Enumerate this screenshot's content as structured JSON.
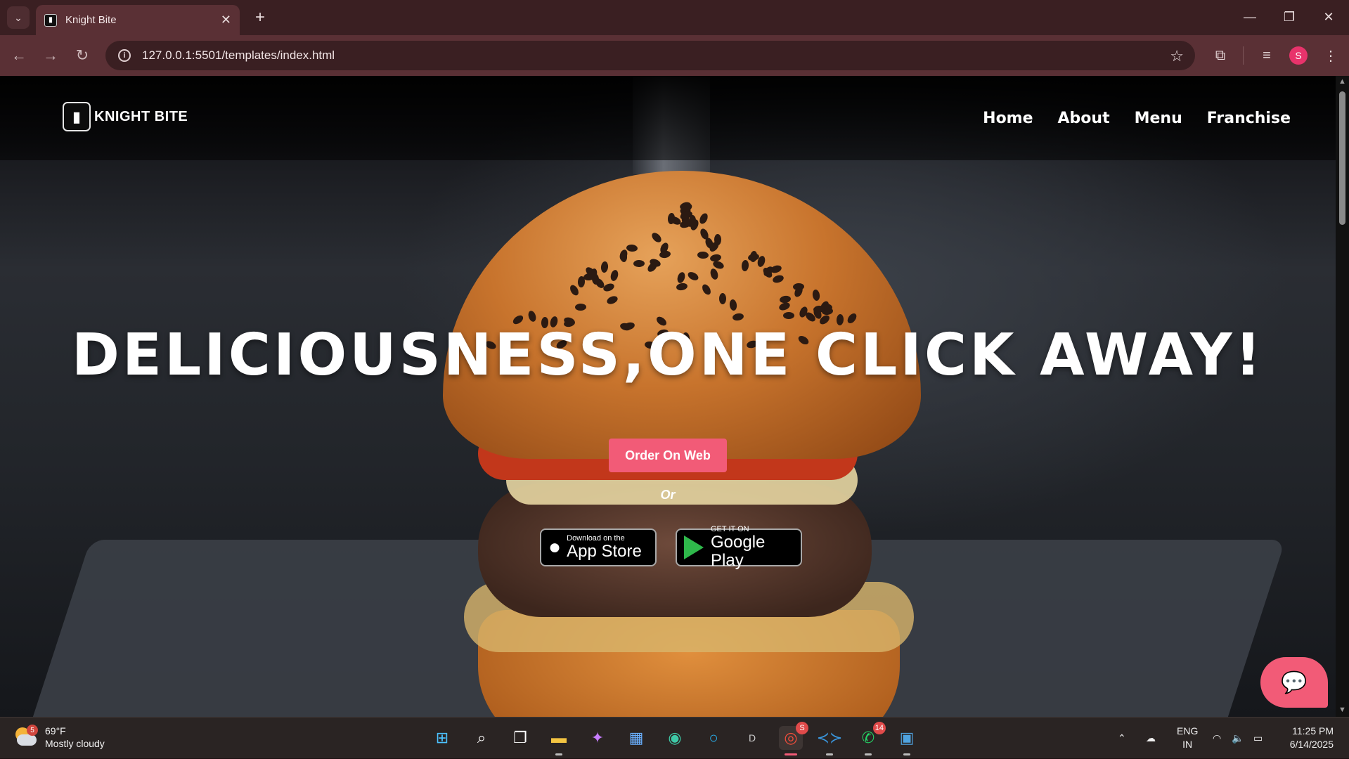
{
  "browser": {
    "tab_title": "Knight Bite",
    "url": "127.0.0.1:5501/templates/index.html",
    "profile_initial": "S"
  },
  "site": {
    "brand": "KNIGHT BITE",
    "nav": [
      "Home",
      "About",
      "Menu",
      "Franchise"
    ],
    "hero_title": "DELICIOUSNESS,ONE CLICK AWAY!",
    "order_button": "Order On Web",
    "or_text": "Or",
    "app_store": {
      "small": "Download on the",
      "big": "App Store"
    },
    "google_play": {
      "small": "GET IT ON",
      "big": "Google Play"
    }
  },
  "taskbar": {
    "weather_temp": "69°F",
    "weather_desc": "Mostly cloudy",
    "weather_badge": "5",
    "whatsapp_badge": "14",
    "chrome_badge": "S",
    "lang_top": "ENG",
    "lang_bottom": "IN",
    "time": "11:25 PM",
    "date": "6/14/2025"
  },
  "colors": {
    "accent": "#f25b77",
    "chrome_bg": "#3a1f22",
    "toolbar_bg": "#5a3035"
  }
}
